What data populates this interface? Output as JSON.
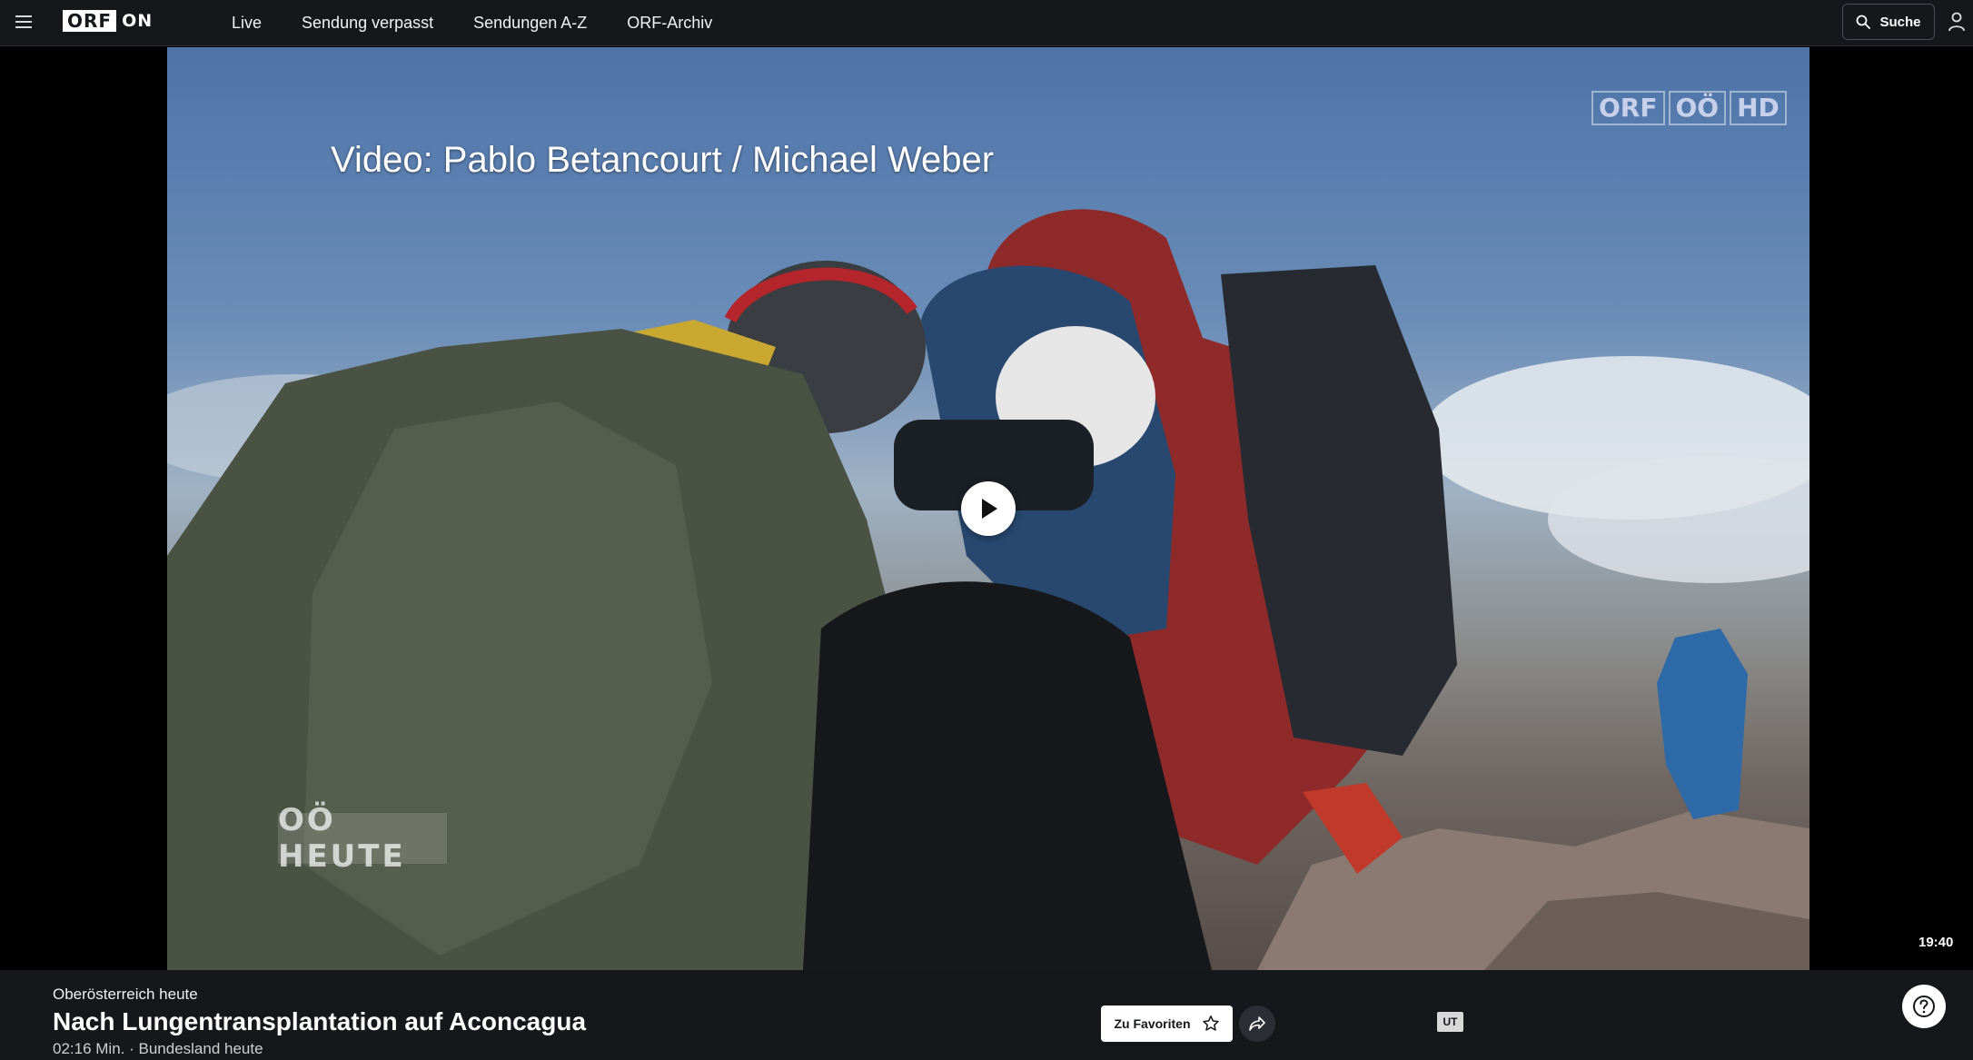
{
  "brand": {
    "logo_box": "ORF",
    "logo_suffix": "ON"
  },
  "nav": {
    "items": [
      {
        "label": "Live"
      },
      {
        "label": "Sendung verpasst"
      },
      {
        "label": "Sendungen A-Z"
      },
      {
        "label": "ORF-Archiv"
      }
    ]
  },
  "search": {
    "label": "Suche"
  },
  "video": {
    "caption": "Video: Pablo Betancourt / Michael Weber",
    "channel_logo": [
      "ORF",
      "OÖ",
      "HD"
    ],
    "show_watermark": "OÖ HEUTE",
    "clock": "19:40"
  },
  "info": {
    "show_name": "Oberösterreich heute",
    "title": "Nach Lungentransplantation auf Aconcagua",
    "meta": "02:16 Min. · Bundesland heute",
    "favorite_label": "Zu Favoriten",
    "subtitle_badge": "UT"
  },
  "icons": {
    "menu": "hamburger-icon",
    "search": "search-icon",
    "user": "user-icon",
    "play": "play-icon",
    "star": "star-icon",
    "share": "share-icon",
    "help": "help-icon"
  },
  "colors": {
    "topbar_bg": "#15171b",
    "infobar_bg": "#15171b",
    "accent": "#ffffff"
  }
}
